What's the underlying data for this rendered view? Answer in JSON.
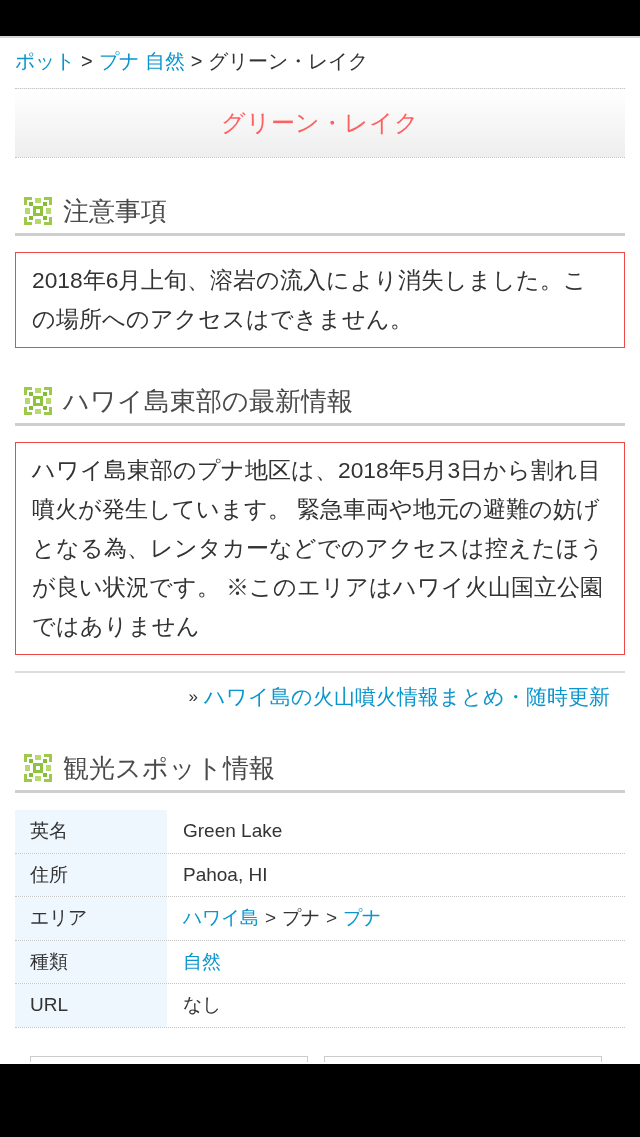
{
  "breadcrumb": [
    {
      "text": "ポット",
      "kind": "link"
    },
    {
      "text": ">",
      "kind": "separator"
    },
    {
      "text": "プナ",
      "kind": "link"
    },
    {
      "text": "自然",
      "kind": "link"
    },
    {
      "text": ">",
      "kind": "separator"
    },
    {
      "text": "グリーン・レイク",
      "kind": "current"
    }
  ],
  "page_title": "グリーン・レイク",
  "sections": [
    {
      "heading": "注意事項",
      "notice": "2018年6月上旬、溶岩の流入により消失しました。この場所へのアクセスはできません。"
    },
    {
      "heading": "ハワイ島東部の最新情報",
      "notice": "ハワイ島東部のプナ地区は、2018年5月3日から割れ目噴火が発生しています。 緊急車両や地元の避難の妨げとなる為、レンタカーなどでのアクセスは控えたほうが良い状況です。 ※このエリアはハワイ火山国立公園ではありません",
      "more_link": {
        "prefix": "»",
        "text": "ハワイ島の火山噴火情報まとめ・随時更新"
      }
    },
    {
      "heading": "観光スポット情報",
      "table": [
        {
          "label": "英名",
          "value": [
            {
              "text": "Green Lake",
              "kind": "text"
            }
          ]
        },
        {
          "label": "住所",
          "value": [
            {
              "text": "Pahoa, HI",
              "kind": "text"
            }
          ]
        },
        {
          "label": "エリア",
          "value": [
            {
              "text": "ハワイ島",
              "kind": "link"
            },
            {
              "text": ">",
              "kind": "separator"
            },
            {
              "text": "プナ",
              "kind": "text"
            },
            {
              "text": ">",
              "kind": "separator"
            },
            {
              "text": "プナ",
              "kind": "link"
            }
          ]
        },
        {
          "label": "種類",
          "value": [
            {
              "text": "自然",
              "kind": "link"
            }
          ]
        },
        {
          "label": "URL",
          "value": [
            {
              "text": "なし",
              "kind": "text"
            }
          ]
        }
      ]
    }
  ]
}
